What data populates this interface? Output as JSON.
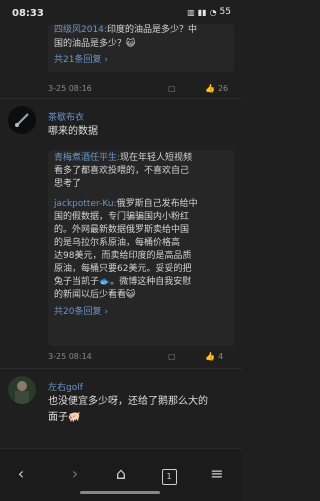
{
  "status": {
    "time": "08:33",
    "battery": "55"
  },
  "thread1": {
    "reply_line1_user": "四级风2014:",
    "reply_line1_text": "印度的油品是多少？中",
    "reply_line2": "国的油品是多少？😺",
    "more": "共21条回复",
    "date": "3-25 08:16",
    "likes": "26"
  },
  "comment2": {
    "name": "茶歇布衣",
    "text": "哪来的数据",
    "replies": [
      [
        "青梅煮酒任平生:",
        "现在年轻人短视频"
      ],
      [
        "",
        "看多了都喜欢投喂的，不喜欢自己"
      ],
      [
        "",
        "思考了"
      ]
    ],
    "reply2": [
      [
        "jackpotter-Ku:",
        "俄罗斯自己发布给中"
      ],
      [
        "",
        "国的假数据，专门骗骗国内小粉红"
      ],
      [
        "",
        "的。外网最新数据俄罗斯卖给中国"
      ],
      [
        "",
        "的是乌拉尔系原油，每桶价格高"
      ],
      [
        "",
        "达98美元，而卖给印度的是高品质"
      ],
      [
        "",
        "原油，每桶只要62美元。妥妥的把"
      ],
      [
        "",
        "兔子当凯子🐟。微博这种自我安慰"
      ],
      [
        "",
        "的新闻以后少看看😺"
      ]
    ],
    "more": "共20条回复",
    "date": "3-25 08:14",
    "likes": "4"
  },
  "comment3": {
    "name": "左右golf",
    "text_line1": "也没便宜多少呀，还给了鹅那么大的",
    "text_line2": "面子🐖"
  },
  "nav": {
    "page": "1"
  }
}
